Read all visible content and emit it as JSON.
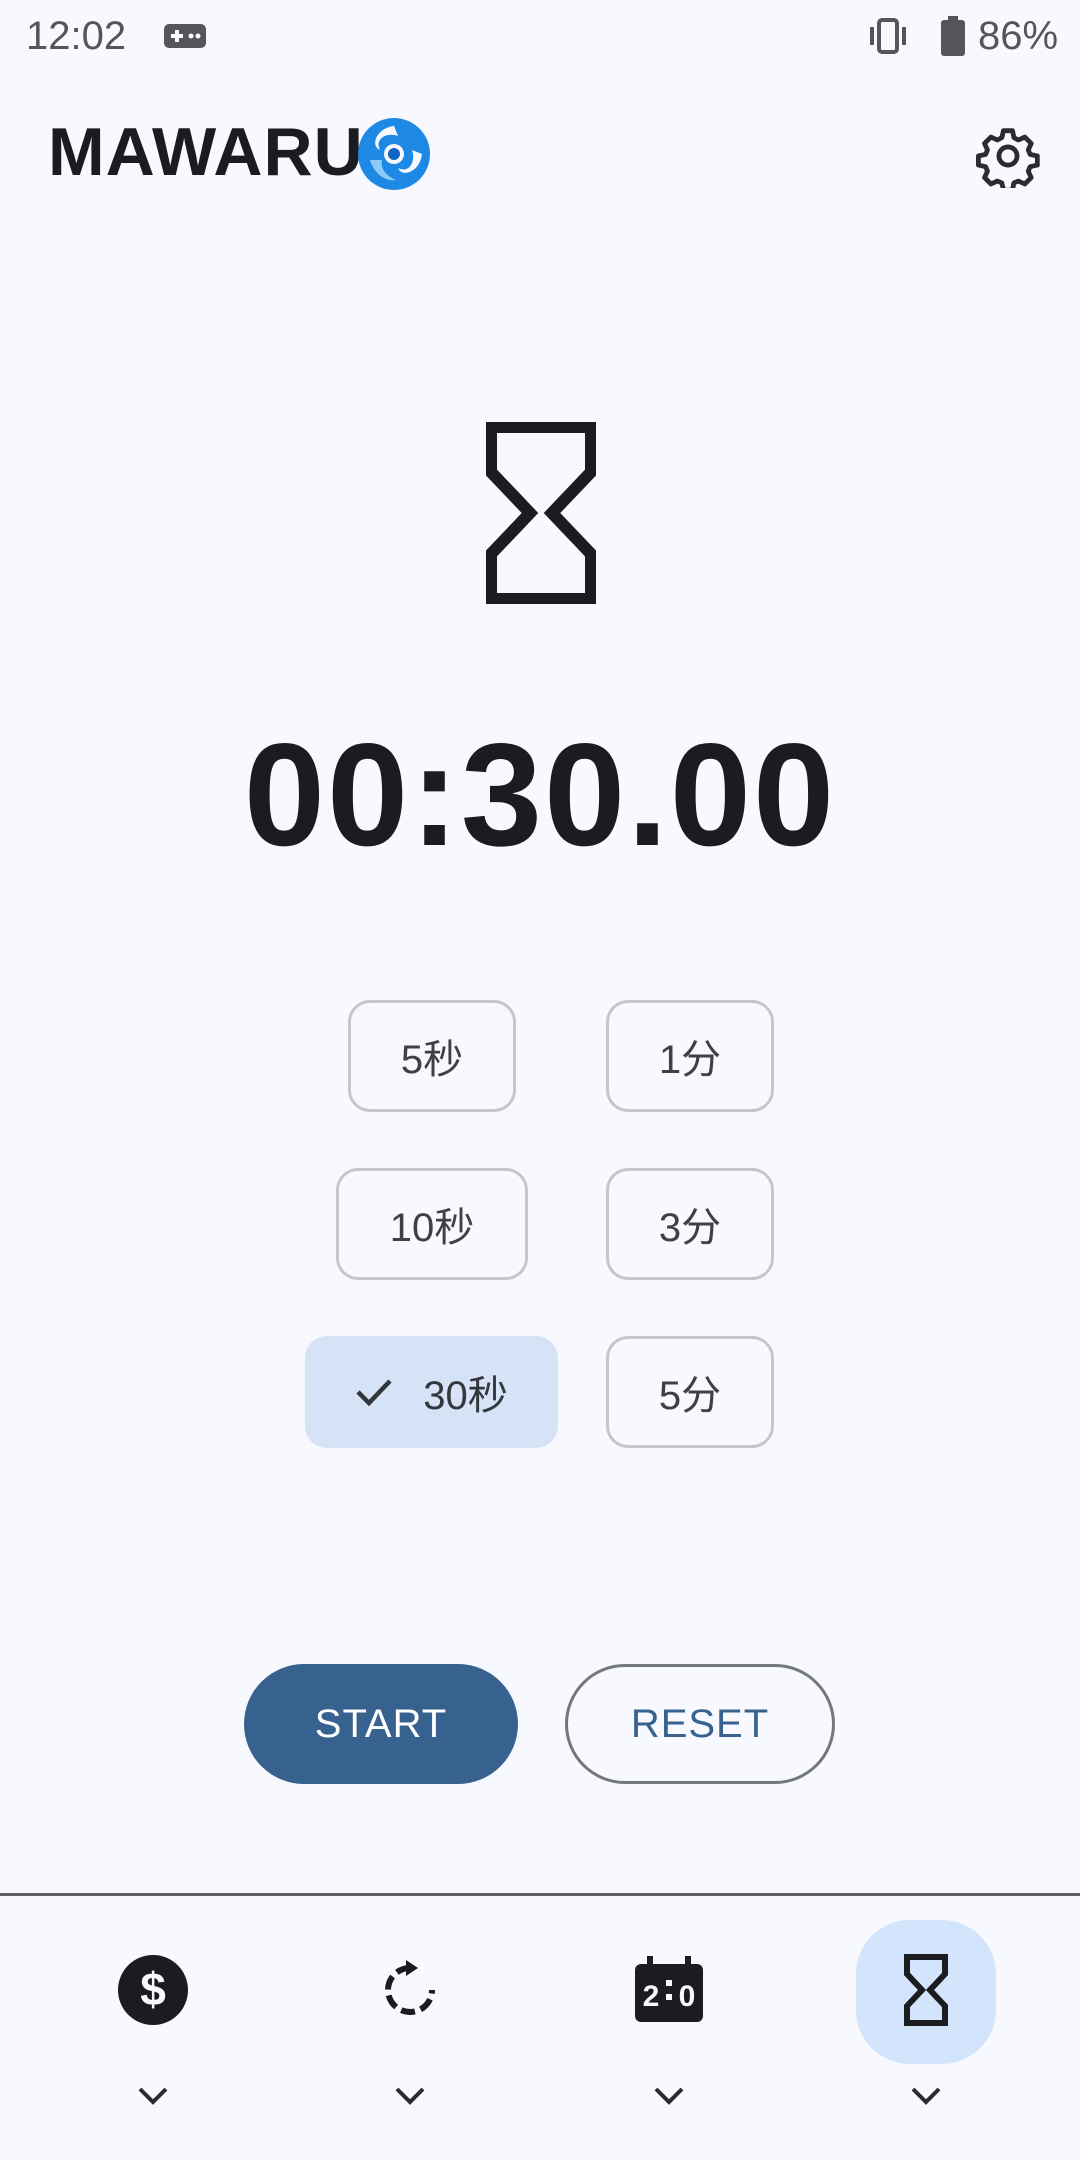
{
  "status_bar": {
    "time": "12:02",
    "battery_percent": "86%",
    "icons": [
      "gamepad-icon",
      "vibrate-icon",
      "battery-icon"
    ]
  },
  "app_bar": {
    "title": "MAWARU",
    "logo_icon": "swirl-logo-icon",
    "settings_icon": "gear-icon"
  },
  "timer": {
    "icon": "hourglass-icon",
    "display": "00:30.00"
  },
  "presets": {
    "left": [
      {
        "label": "5秒",
        "selected": false
      },
      {
        "label": "10秒",
        "selected": false
      },
      {
        "label": "30秒",
        "selected": true
      }
    ],
    "right": [
      {
        "label": "1分",
        "selected": false
      },
      {
        "label": "3分",
        "selected": false
      },
      {
        "label": "5分",
        "selected": false
      }
    ]
  },
  "actions": {
    "start_label": "START",
    "reset_label": "RESET"
  },
  "bottom_nav": {
    "items": [
      {
        "icon": "dollar-icon",
        "active": false
      },
      {
        "icon": "rotate-icon",
        "active": false
      },
      {
        "icon": "scoreboard-icon",
        "active": false
      },
      {
        "icon": "hourglass-icon",
        "active": true
      }
    ]
  },
  "colors": {
    "background": "#F8F9FE",
    "primary": "#37618E",
    "selected_chip": "#D6E3F6",
    "active_nav": "#D3E4FD",
    "logo_blue": "#1E88E5"
  }
}
